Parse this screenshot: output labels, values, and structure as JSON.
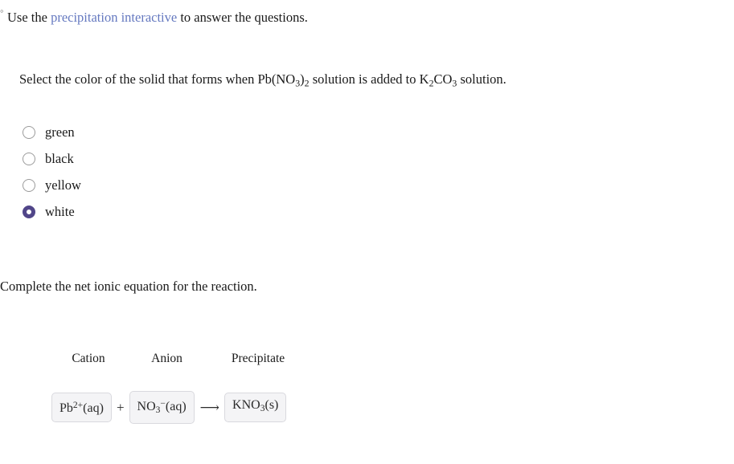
{
  "intro": {
    "bullet": "◦",
    "before_link": "Use the ",
    "link_text": "precipitation interactive",
    "after_link": " to answer the questions.",
    "link_color": "#6579c0"
  },
  "question1": {
    "prompt_part1": "Select the color of the solid that forms when Pb(NO",
    "prompt_sub1": "3",
    "prompt_part2": ")",
    "prompt_sub2": "2",
    "prompt_part3": " solution is added to K",
    "prompt_sub3": "2",
    "prompt_part4": "CO",
    "prompt_sub4": "3",
    "prompt_part5": " solution.",
    "prompt_plain": "Select the color of the solid that forms when Pb(NO3)2 solution is added to K2CO3 solution.",
    "selected_value": "white",
    "selected_color": "#514689",
    "options": [
      {
        "label": "green",
        "selected": false
      },
      {
        "label": "black",
        "selected": false
      },
      {
        "label": "yellow",
        "selected": false
      },
      {
        "label": "white",
        "selected": true
      }
    ]
  },
  "question2": {
    "prompt": "Complete the net ionic equation for the reaction.",
    "headers": {
      "cation": "Cation",
      "anion": "Anion",
      "precipitate": "Precipitate"
    },
    "equation": {
      "cation": {
        "formula": "Pb",
        "charge": "2+",
        "state": "(aq)",
        "full": "Pb2+(aq)"
      },
      "plus": "+",
      "anion": {
        "formula": "NO",
        "sub": "3",
        "charge": "−",
        "state": "(aq)",
        "full": "NO3-(aq)"
      },
      "arrow": "⟶",
      "precipitate": {
        "formula": "KNO",
        "sub": "3",
        "state": "(s)",
        "full": "KNO3(s)"
      }
    },
    "box_background": "#f4f4f6",
    "box_border": "#d9d9de"
  }
}
